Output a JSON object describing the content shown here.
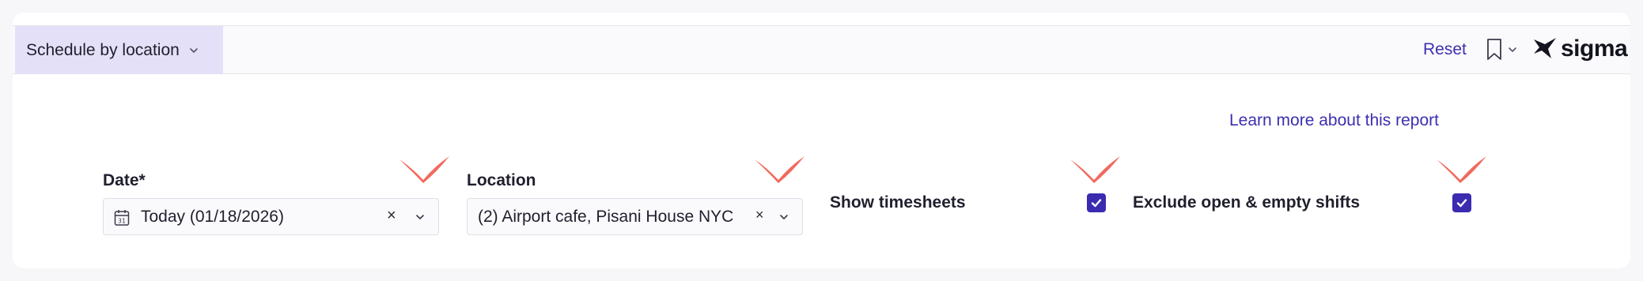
{
  "header": {
    "tab_label": "Schedule by location",
    "reset_label": "Reset",
    "logo_text": "sigma"
  },
  "report": {
    "learn_more": "Learn more about this report"
  },
  "filters": {
    "date": {
      "label": "Date*",
      "value": "Today (01/18/2026)",
      "clear_glyph": "×"
    },
    "location": {
      "label": "Location",
      "value": "(2) Airport cafe, Pisani House NYC",
      "clear_glyph": "×"
    },
    "show_timesheets": {
      "label": "Show timesheets",
      "checked": true
    },
    "exclude_open_empty": {
      "label": "Exclude open & empty shifts",
      "checked": true
    }
  },
  "colors": {
    "accent": "#3a2bb0",
    "link": "#3c2fb0",
    "tab_bg": "#e4e0f7",
    "marker": "#f06a5e"
  },
  "icons": [
    "chevron-down-icon",
    "bookmark-icon",
    "sigma-logo-icon",
    "calendar-icon",
    "close-icon",
    "checkmark-icon",
    "annotation-chevron-marker"
  ]
}
